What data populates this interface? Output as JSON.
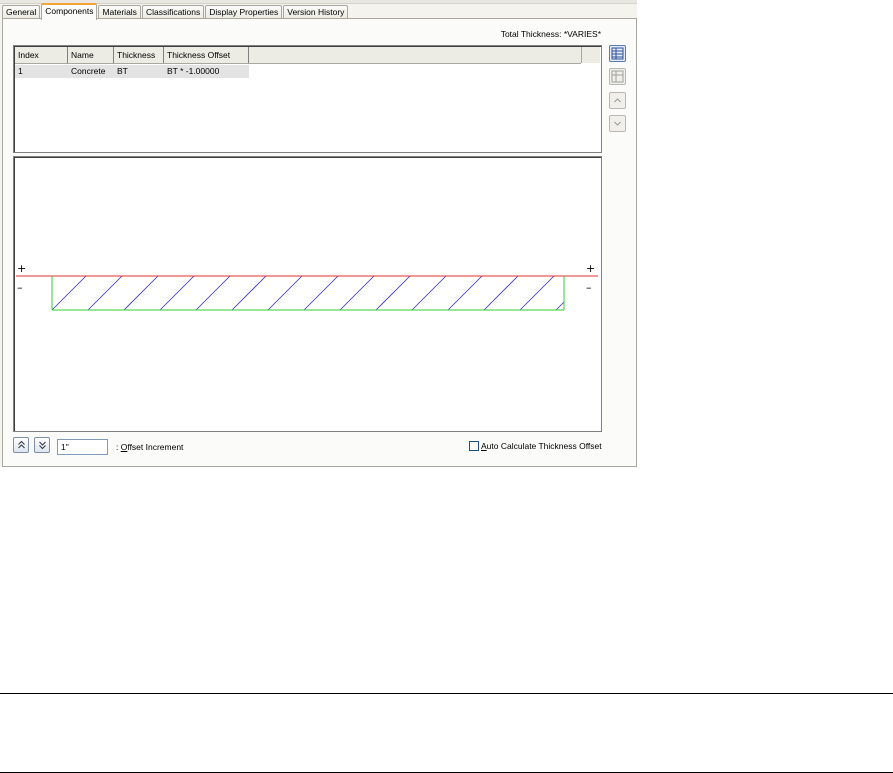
{
  "tabs": [
    {
      "label": "General"
    },
    {
      "label": "Components"
    },
    {
      "label": "Materials"
    },
    {
      "label": "Classifications"
    },
    {
      "label": "Display Properties"
    },
    {
      "label": "Version History"
    }
  ],
  "active_tab": "Components",
  "total_thickness": "Total Thickness: *VARIES*",
  "grid": {
    "columns": [
      "Index",
      "Name",
      "Thickness",
      "Thickness Offset"
    ],
    "rows": [
      {
        "index": "1",
        "name": "Concrete",
        "thickness": "BT",
        "offset": "BT * -1.00000"
      }
    ]
  },
  "side_buttons": [
    {
      "icon": "add-component-icon",
      "enabled": true
    },
    {
      "icon": "delete-component-icon",
      "enabled": false
    },
    {
      "icon": "move-up-icon",
      "enabled": false
    },
    {
      "icon": "move-down-icon",
      "enabled": false
    }
  ],
  "preview": {
    "plus_symbol": "+",
    "minus_symbol": "–",
    "baseline_color": "#e03030",
    "bottom_line_color": "#33cc33",
    "hatch_color": "#3030cc"
  },
  "offset_increment": {
    "value": "1\"",
    "label_prefix": ": ",
    "label_mnemonic": "O",
    "label_rest": "ffset Increment"
  },
  "auto_calculate": {
    "checked": false,
    "label_mnemonic": "A",
    "label_rest": "uto Calculate Thickness Offset"
  }
}
